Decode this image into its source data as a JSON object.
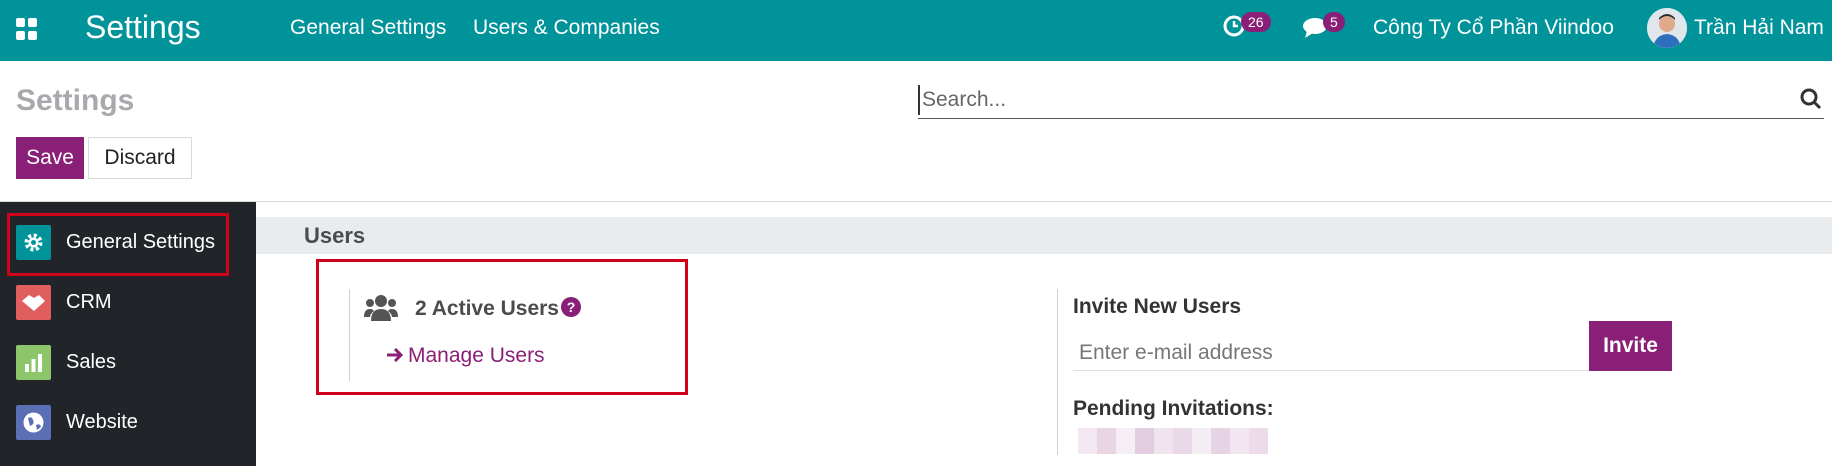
{
  "navbar": {
    "brand": "Settings",
    "menu": [
      "General Settings",
      "Users & Companies"
    ],
    "activity_count": "26",
    "message_count": "5",
    "company": "Công Ty Cổ Phần Viindoo",
    "user_name": "Trần Hải Nam",
    "color": "#00939a"
  },
  "control_panel": {
    "title": "Settings",
    "search_placeholder": "Search...",
    "save_label": "Save",
    "discard_label": "Discard",
    "accent": "#8a1f77"
  },
  "sidebar": {
    "items": [
      {
        "label": "General Settings",
        "icon": "gear-icon",
        "color": "#00939a",
        "selected": true
      },
      {
        "label": "CRM",
        "icon": "handshake-icon",
        "color": "#e05e5e"
      },
      {
        "label": "Sales",
        "icon": "chart-icon",
        "color": "#8dc56b"
      },
      {
        "label": "Website",
        "icon": "globe-icon",
        "color": "#5b6fb5"
      }
    ]
  },
  "users_section": {
    "title": "Users",
    "active_users": "2 Active Users",
    "manage_link": "Manage Users",
    "invite_title": "Invite New Users",
    "email_placeholder": "Enter e-mail address",
    "invite_label": "Invite",
    "pending_title": "Pending Invitations:"
  }
}
